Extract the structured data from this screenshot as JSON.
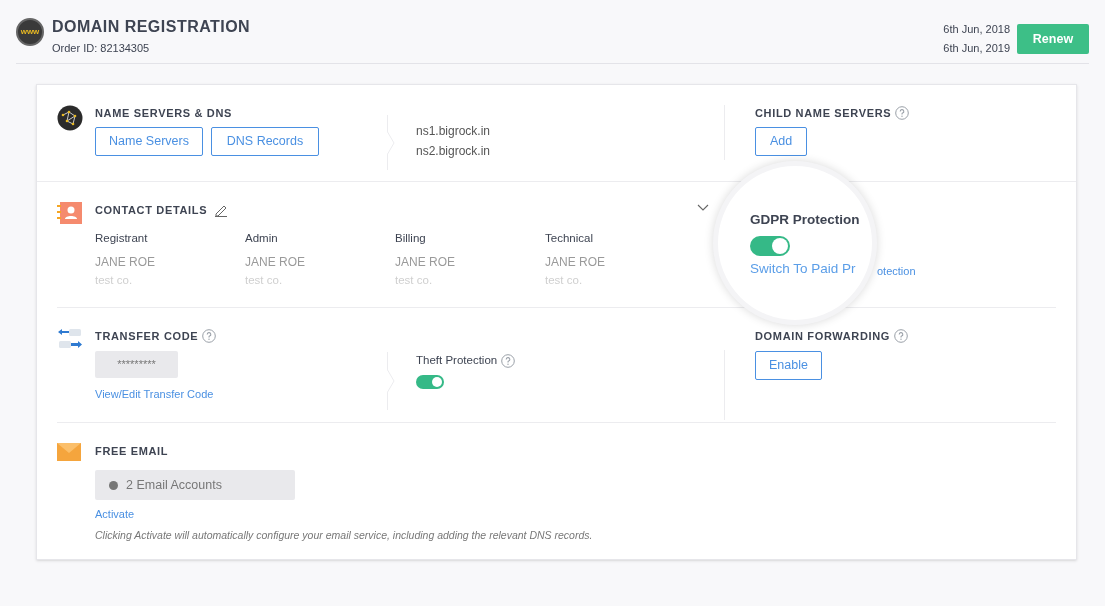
{
  "header": {
    "logo_text": "www",
    "title": "DOMAIN REGISTRATION",
    "order_id": "Order ID: 82134305",
    "dates": [
      "6th Jun, 2018",
      "6th Jun, 2019"
    ],
    "renew_button": "Renew"
  },
  "name_servers": {
    "title": "NAME SERVERS & DNS",
    "buttons": [
      "Name Servers",
      "DNS Records"
    ],
    "servers": [
      "ns1.bigrock.in",
      "ns2.bigrock.in"
    ]
  },
  "child_name_servers": {
    "title": "CHILD NAME SERVERS",
    "button": "Add"
  },
  "contact_details": {
    "title": "CONTACT DETAILS",
    "expanded": false,
    "contacts": [
      {
        "role": "Registrant",
        "name": "JANE ROE",
        "company": "test co."
      },
      {
        "role": "Admin",
        "name": "JANE ROE",
        "company": "test co."
      },
      {
        "role": "Billing",
        "name": "JANE ROE",
        "company": "test co."
      },
      {
        "role": "Technical",
        "name": "JANE ROE",
        "company": "test co."
      }
    ]
  },
  "gdpr": {
    "title": "GDPR Protection",
    "on": true,
    "link_magnified": "Switch To Paid Pr",
    "link_rest": "otection"
  },
  "transfer_code": {
    "title": "TRANSFER CODE",
    "masked_code": "*********",
    "link": "View/Edit Transfer Code"
  },
  "theft_protection": {
    "label": "Theft Protection",
    "on": true
  },
  "domain_forwarding": {
    "title": "DOMAIN FORWARDING",
    "button": "Enable"
  },
  "free_email": {
    "title": "FREE EMAIL",
    "accounts": "2 Email Accounts",
    "link": "Activate",
    "note": "Clicking Activate will automatically configure your email service, including adding the relevant DNS records."
  }
}
